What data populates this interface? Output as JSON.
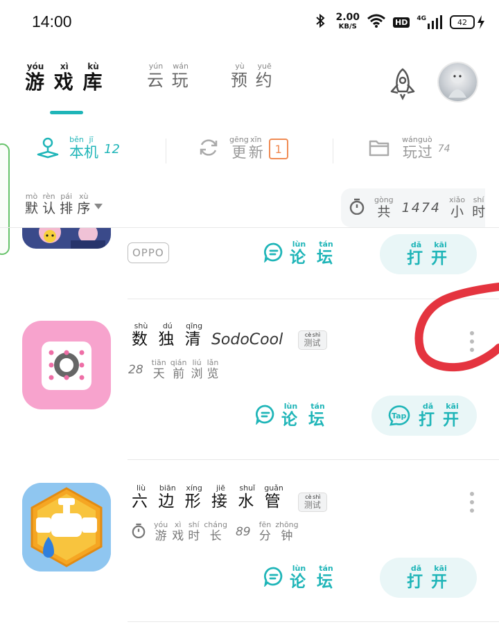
{
  "status_bar": {
    "time": "14:00",
    "net_speed_value": "2.00",
    "net_speed_unit": "KB/S",
    "hd": "HD",
    "signal": "4G",
    "battery": "42"
  },
  "tabs": {
    "games": {
      "chars": [
        "游",
        "戏",
        "库"
      ],
      "pinyin": [
        "yóu",
        "xì",
        "kù"
      ]
    },
    "cloud": {
      "chars": [
        "云",
        "玩"
      ],
      "pinyin": [
        "yún",
        "wán"
      ]
    },
    "reserve": {
      "chars": [
        "预",
        "约"
      ],
      "pinyin": [
        "yù",
        "yuē"
      ]
    }
  },
  "filters": {
    "local": {
      "chars": [
        "本",
        "机"
      ],
      "pinyin": [
        "běn",
        "jī"
      ],
      "count": "12"
    },
    "update": {
      "chars": [
        "更",
        "新"
      ],
      "pinyin": [
        "gēng",
        "xīn"
      ],
      "count": "1"
    },
    "played": {
      "chars": [
        "玩",
        "过"
      ],
      "pinyin": [
        "wán",
        "guò"
      ],
      "count": "74"
    }
  },
  "sort": {
    "chars": [
      "默",
      "认",
      "排",
      "序"
    ],
    "pinyin": [
      "mò",
      "rèn",
      "pái",
      "xù"
    ]
  },
  "total_time": {
    "pre": {
      "chars": [
        "共"
      ],
      "pinyin": [
        "gòng"
      ]
    },
    "value": "1474",
    "post": {
      "chars": [
        "小",
        "时"
      ],
      "pinyin": [
        "xiǎo",
        "shí"
      ]
    }
  },
  "common": {
    "forum": {
      "chars": [
        "论",
        "坛"
      ],
      "pinyin": [
        "lùn",
        "tán"
      ]
    },
    "open": {
      "chars": [
        "打",
        "开"
      ],
      "pinyin": [
        "dǎ",
        "kāi"
      ]
    },
    "test": {
      "chars": [
        "测",
        "试"
      ],
      "pinyin": [
        "cè",
        "shì"
      ]
    },
    "tap_label": "Tap"
  },
  "games": [
    {
      "publisher_tag": "OPPO"
    },
    {
      "title": {
        "chars": [
          "数",
          "独",
          "清"
        ],
        "pinyin": [
          "shù",
          "dú",
          "qīng"
        ],
        "latin": "SodoCool"
      },
      "sub": {
        "pre": "28",
        "chars": [
          "天",
          "前",
          "浏",
          "览"
        ],
        "pinyin": [
          "tiān",
          "qián",
          "liú",
          "lǎn"
        ]
      }
    },
    {
      "title": {
        "chars": [
          "六",
          "边",
          "形",
          "接",
          "水",
          "管"
        ],
        "pinyin": [
          "liù",
          "biān",
          "xíng",
          "jiē",
          "shuǐ",
          "guǎn"
        ]
      },
      "sub": {
        "a": {
          "chars": [
            "游",
            "戏",
            "时",
            "长"
          ],
          "pinyin": [
            "yóu",
            "xì",
            "shí",
            "cháng"
          ]
        },
        "value": "89",
        "b": {
          "chars": [
            "分",
            "钟"
          ],
          "pinyin": [
            "fēn",
            "zhōng"
          ]
        }
      }
    }
  ],
  "colors": {
    "accent": "#1fb5b8",
    "update_badge": "#f08a52",
    "annotation": "#e4343f"
  }
}
